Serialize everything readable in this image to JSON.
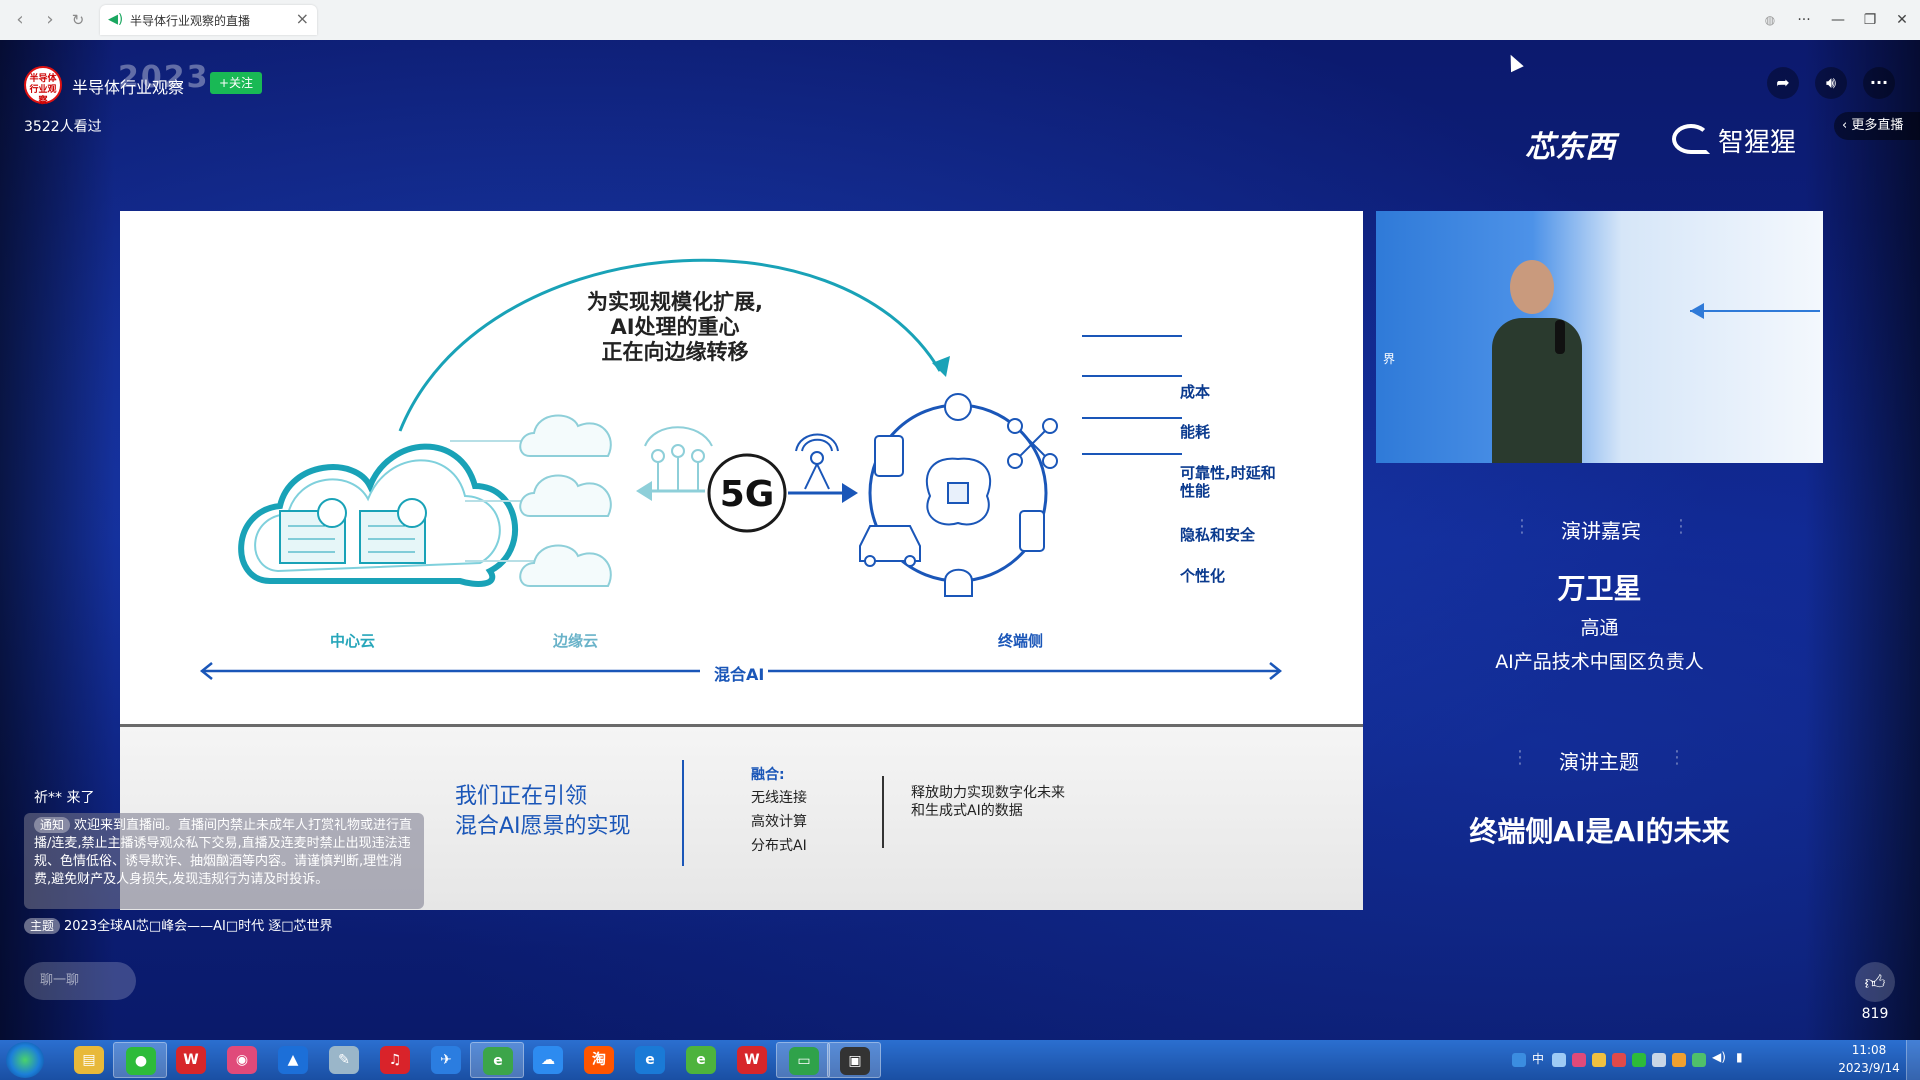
{
  "browser": {
    "tab_title": "半导体行业观察的直播",
    "nav": {
      "back": "‹",
      "forward": "›",
      "reload": "↻"
    },
    "controls": {
      "menu": "···",
      "minimize": "—",
      "restore": "❐",
      "close": "✕"
    }
  },
  "host": {
    "avatar_text": "半导体\n行业观察",
    "name": "半导体行业观察",
    "follow_label": "+关注",
    "viewers": "3522人看过",
    "event_logo": "2023"
  },
  "top_actions": {
    "more_live": "更多直播"
  },
  "brands": {
    "left": "芯东西",
    "right": "智猩猩"
  },
  "slide": {
    "headline": [
      "为实现规模化扩展,",
      "AI处理的重心",
      "正在向边缘转移"
    ],
    "center_5g": "5G",
    "label_center_cloud": "中心云",
    "label_edge_cloud": "边缘云",
    "label_device": "终端侧",
    "label_hybrid": "混合AI",
    "benefits": [
      "成本",
      "能耗",
      "可靠性,时延和\n性能",
      "隐私和安全",
      "个性化"
    ],
    "bottom_title": [
      "我们正在引领",
      "混合AI愿景的实现"
    ],
    "fusion_title": "融合:",
    "fusion_items": [
      "无线连接",
      "高效计算",
      "分布式AI"
    ],
    "release_text": [
      "释放助力实现数字化未来",
      "和生成式AI的数据"
    ]
  },
  "speaker_panel": {
    "video_mark": "界",
    "guest_label": "演讲嘉宾",
    "name": "万卫星",
    "org": "高通",
    "role": "AI产品技术中国区负责人",
    "topic_label": "演讲主题",
    "topic": "终端侧AI是AI的未来"
  },
  "chat": {
    "join_message": "祈** 来了",
    "notice_tag": "通知",
    "notice_text": "欢迎来到直播间。直播间内禁止未成年人打赏礼物或进行直播/连麦,禁止主播诱导观众私下交易,直播及连麦时禁止出现违法违规、色情低俗、诱导欺诈、抽烟酗酒等内容。请谨慎判断,理性消费,避免财产及人身损失,发现违规行为请及时投诉。",
    "theme_tag": "主题",
    "theme_text": "2023全球AI芯□峰会——AI□时代 逐□芯世界",
    "input_placeholder": "聊一聊"
  },
  "like": {
    "count": "819"
  },
  "taskbar": {
    "apps": [
      {
        "name": "file-explorer",
        "glyph": "▤",
        "color": "#e8b93a"
      },
      {
        "name": "wechat",
        "glyph": "●",
        "color": "#2dbb3a",
        "active": true
      },
      {
        "name": "wps-spreadsheet",
        "glyph": "W",
        "color": "#d7262a"
      },
      {
        "name": "color-app",
        "glyph": "◉",
        "color": "#e04a7a"
      },
      {
        "name": "mountain-app",
        "glyph": "▲",
        "color": "#1c6fd8"
      },
      {
        "name": "notepad",
        "glyph": "✎",
        "color": "#9ab6c9"
      },
      {
        "name": "music-app",
        "glyph": "♫",
        "color": "#d9232a"
      },
      {
        "name": "mail-app",
        "glyph": "✈",
        "color": "#2b7de0"
      },
      {
        "name": "browser-green",
        "glyph": "e",
        "color": "#3ca54a",
        "active": true
      },
      {
        "name": "baidu-netdisk",
        "glyph": "☁",
        "color": "#2d8bf0"
      },
      {
        "name": "taobao",
        "glyph": "淘",
        "color": "#ff5500"
      },
      {
        "name": "internet-explorer",
        "glyph": "e",
        "color": "#1a7ad6"
      },
      {
        "name": "browser-360",
        "glyph": "e",
        "color": "#4db33d"
      },
      {
        "name": "wps-office",
        "glyph": "W",
        "color": "#d7262a"
      },
      {
        "name": "remote-desktop",
        "glyph": "▭",
        "color": "#2fa24a",
        "active": true
      },
      {
        "name": "media-app",
        "glyph": "▣",
        "color": "#333333",
        "active": true
      }
    ],
    "tray": {
      "ime": "中",
      "time": "11:08",
      "date": "2023/9/14"
    }
  }
}
